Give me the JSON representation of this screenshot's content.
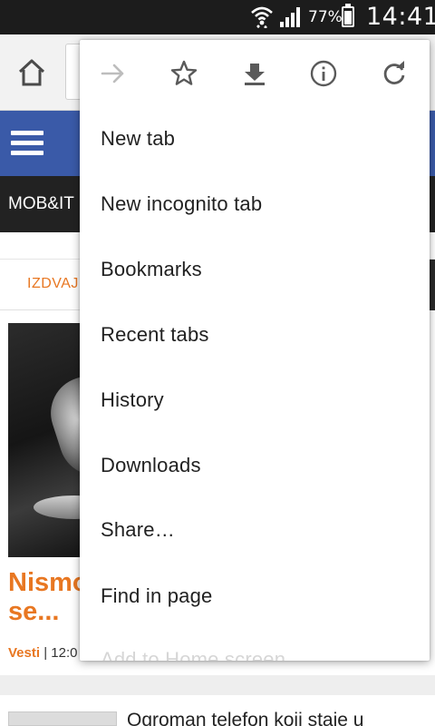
{
  "status_bar": {
    "battery_percent": "77%",
    "time": "14:41",
    "icons": [
      "wifi-icon",
      "signal-icon",
      "battery-icon"
    ]
  },
  "toolbar": {
    "icons": [
      "home-icon"
    ]
  },
  "page": {
    "nav_item": "MOB&IT",
    "tab_label": "IZDVAJ",
    "article_title_line1": "Nismo",
    "article_title_line2": "se...",
    "article_category": "Vesti",
    "article_meta_rest": "| 12:0",
    "next_article_title": "Ogroman telefon koji staje u"
  },
  "menu": {
    "icons": [
      "forward-arrow-icon",
      "star-icon",
      "download-icon",
      "info-icon",
      "reload-icon"
    ],
    "items": [
      {
        "label": "New tab"
      },
      {
        "label": "New incognito tab"
      },
      {
        "label": "Bookmarks"
      },
      {
        "label": "Recent tabs"
      },
      {
        "label": "History"
      },
      {
        "label": "Downloads"
      },
      {
        "label": "Share…"
      },
      {
        "label": "Find in page"
      },
      {
        "label": "Add to Home screen"
      }
    ]
  },
  "colors": {
    "status_bar": "#1c1c1c",
    "toolbar": "#f2f2f2",
    "site_header": "#3a5aa8",
    "site_nav": "#222222",
    "accent_orange": "#e87722",
    "menu_icon": "#5a5a5a",
    "menu_icon_disabled": "#bdbdbd"
  }
}
